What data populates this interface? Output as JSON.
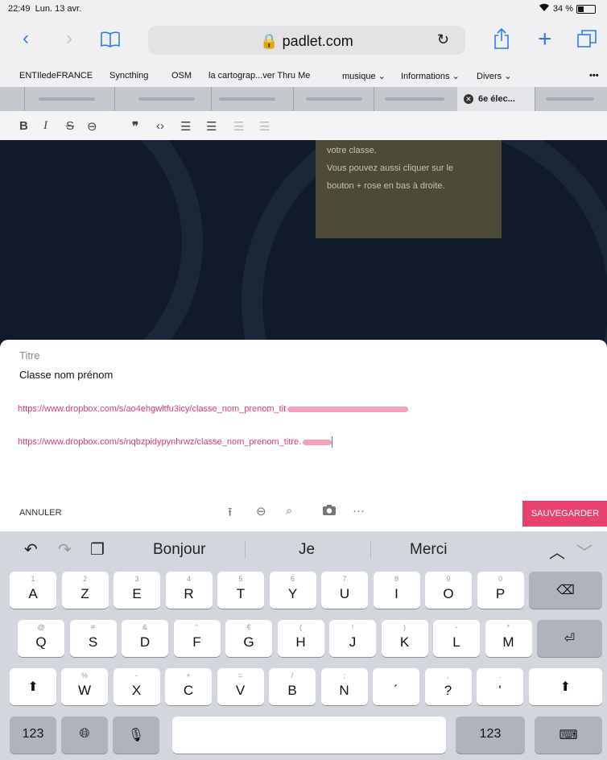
{
  "status": {
    "time": "22:49",
    "date": "Lun. 13 avr.",
    "battery": "34 %"
  },
  "browser": {
    "url": "padlet.com",
    "bookmarks": [
      "ENTIledeFRANCE",
      "Syncthing",
      "OSM",
      "la cartograp...ver Thru Me",
      "musique ⌄",
      "Informations ⌄",
      "Divers ⌄",
      "•••"
    ],
    "active_tab": "6e élec..."
  },
  "format_icons": [
    "bold-icon",
    "italic-icon",
    "strikethrough-icon",
    "link-icon",
    "quote-icon",
    "code-icon",
    "bullet-list-icon",
    "numbered-list-icon",
    "outdent-icon",
    "indent-icon"
  ],
  "note": {
    "lines": [
      "votre classe.",
      "Vous pouvez aussi cliquer sur le",
      "bouton + rose en bas à droite."
    ]
  },
  "editor": {
    "title_label": "Titre",
    "title_value": "Classe nom prénom",
    "link1": "https://www.dropbox.com/s/ao4ehgwltfu3icy/classe_nom_prenom_tit",
    "link2": "https://www.dropbox.com/s/nqbzpidypynhrwz/classe_nom_prenom_titre.",
    "cancel": "ANNULER",
    "save": "SAUVEGARDER",
    "more": "···"
  },
  "keyboard": {
    "suggestions": [
      "Bonjour",
      "Je",
      "Merci"
    ],
    "row1": [
      {
        "m": "A",
        "s": "1"
      },
      {
        "m": "Z",
        "s": "2"
      },
      {
        "m": "E",
        "s": "3"
      },
      {
        "m": "R",
        "s": "4"
      },
      {
        "m": "T",
        "s": "5"
      },
      {
        "m": "Y",
        "s": "6"
      },
      {
        "m": "U",
        "s": "7"
      },
      {
        "m": "I",
        "s": "8"
      },
      {
        "m": "O",
        "s": "9"
      },
      {
        "m": "P",
        "s": "0"
      }
    ],
    "row2": [
      {
        "m": "Q",
        "s": "@"
      },
      {
        "m": "S",
        "s": "#"
      },
      {
        "m": "D",
        "s": "&"
      },
      {
        "m": "F",
        "s": "\""
      },
      {
        "m": "G",
        "s": "€"
      },
      {
        "m": "H",
        "s": "("
      },
      {
        "m": "J",
        "s": "!"
      },
      {
        "m": "K",
        "s": ")"
      },
      {
        "m": "L",
        "s": "-"
      },
      {
        "m": "M",
        "s": "*"
      }
    ],
    "row3": [
      {
        "m": "W",
        "s": "%"
      },
      {
        "m": "X",
        "s": "-"
      },
      {
        "m": "C",
        "s": "+"
      },
      {
        "m": "V",
        "s": "="
      },
      {
        "m": "B",
        "s": "/"
      },
      {
        "m": "N",
        "s": ";"
      },
      {
        "m": "´",
        "s": ""
      },
      {
        "m": "?",
        "s": ","
      },
      {
        "m": "'",
        "s": "."
      }
    ],
    "num_label": "123"
  }
}
